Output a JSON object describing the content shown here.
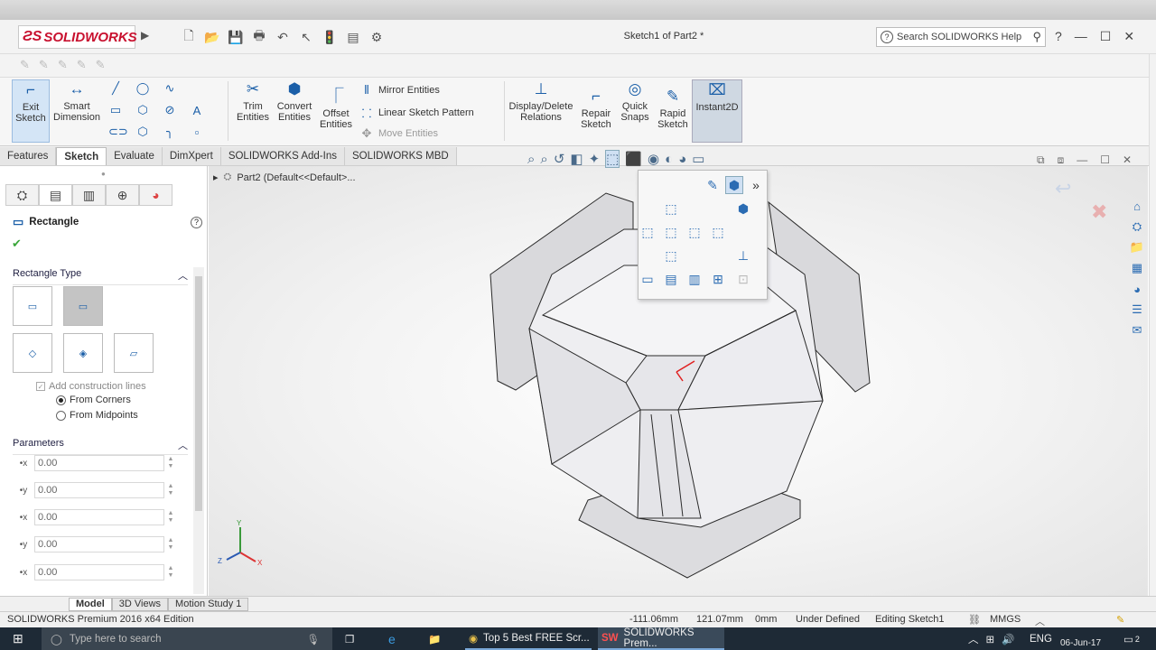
{
  "app": {
    "logo": "SOLIDWORKS",
    "title": "Sketch1 of Part2 *"
  },
  "search": {
    "placeholder": "Search SOLIDWORKS Help"
  },
  "ribbon": {
    "exit_sketch": "Exit\nSketch",
    "smart_dimension": "Smart\nDimension",
    "trim_entities": "Trim\nEntities",
    "convert_entities": "Convert\nEntities",
    "offset_entities": "Offset\nEntities",
    "mirror_entities": "Mirror Entities",
    "linear_sketch_pattern": "Linear Sketch Pattern",
    "move_entities": "Move Entities",
    "display_delete_relations": "Display/Delete\nRelations",
    "repair_sketch": "Repair\nSketch",
    "quick_snaps": "Quick\nSnaps",
    "rapid_sketch": "Rapid\nSketch",
    "instant2d": "Instant2D"
  },
  "tabs": [
    "Features",
    "Sketch",
    "Evaluate",
    "DimXpert",
    "SOLIDWORKS Add-Ins",
    "SOLIDWORKS MBD"
  ],
  "active_tab": "Sketch",
  "tree": {
    "label": "Part2  (Default<<Default>..."
  },
  "panel": {
    "title": "Rectangle",
    "rectangle_type": "Rectangle Type",
    "add_construction_lines": "Add construction lines",
    "from_corners": "From Corners",
    "from_midpoints": "From Midpoints",
    "parameters": "Parameters",
    "params": [
      "0.00",
      "0.00",
      "0.00",
      "0.00",
      "0.00"
    ]
  },
  "bottom_tabs": [
    "Model",
    "3D Views",
    "Motion Study 1"
  ],
  "status": {
    "edition": "SOLIDWORKS Premium 2016 x64 Edition",
    "x": "-111.06mm",
    "y": "121.07mm",
    "z": "0mm",
    "state": "Under Defined",
    "editing": "Editing Sketch1",
    "units": "MMGS"
  },
  "taskbar": {
    "search_placeholder": "Type here to search",
    "chrome_task": "Top 5 Best FREE Scr...",
    "sw_task": "SOLIDWORKS Prem...",
    "lang": "ENG",
    "date": "06-Jun-17",
    "notif_count": "2"
  },
  "colors": {
    "accent": "#1b5fa8",
    "brand": "#c8102e",
    "taskbar": "#1e2a36"
  }
}
